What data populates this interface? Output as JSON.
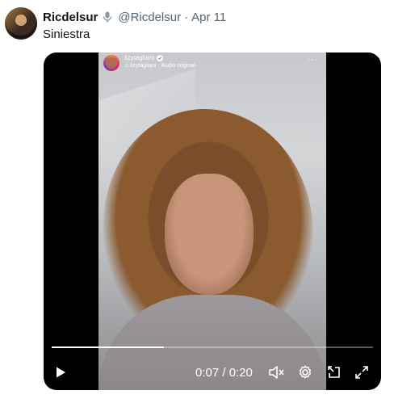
{
  "tweet": {
    "display_name": "Ricdelsur",
    "handle": "@Ricdelsur",
    "separator": "·",
    "date": "Apr 11",
    "text": "Siniestra",
    "icons": {
      "avatar": "user-avatar",
      "badge": "microphone-icon"
    }
  },
  "embed": {
    "username": "lizytagliani",
    "audio_label": "lizytagliani · Audio original",
    "more": "···"
  },
  "player": {
    "current_time": "0:07",
    "duration": "0:20",
    "time_display": "0:07 / 0:20",
    "progress": 0.35,
    "icons": [
      "play-icon",
      "volume-muted-icon",
      "settings-gear-icon",
      "pop-out-icon",
      "fullscreen-icon"
    ]
  },
  "colors": {
    "text": "#0f1419",
    "secondary": "#536471",
    "player_bg": "#000000"
  }
}
